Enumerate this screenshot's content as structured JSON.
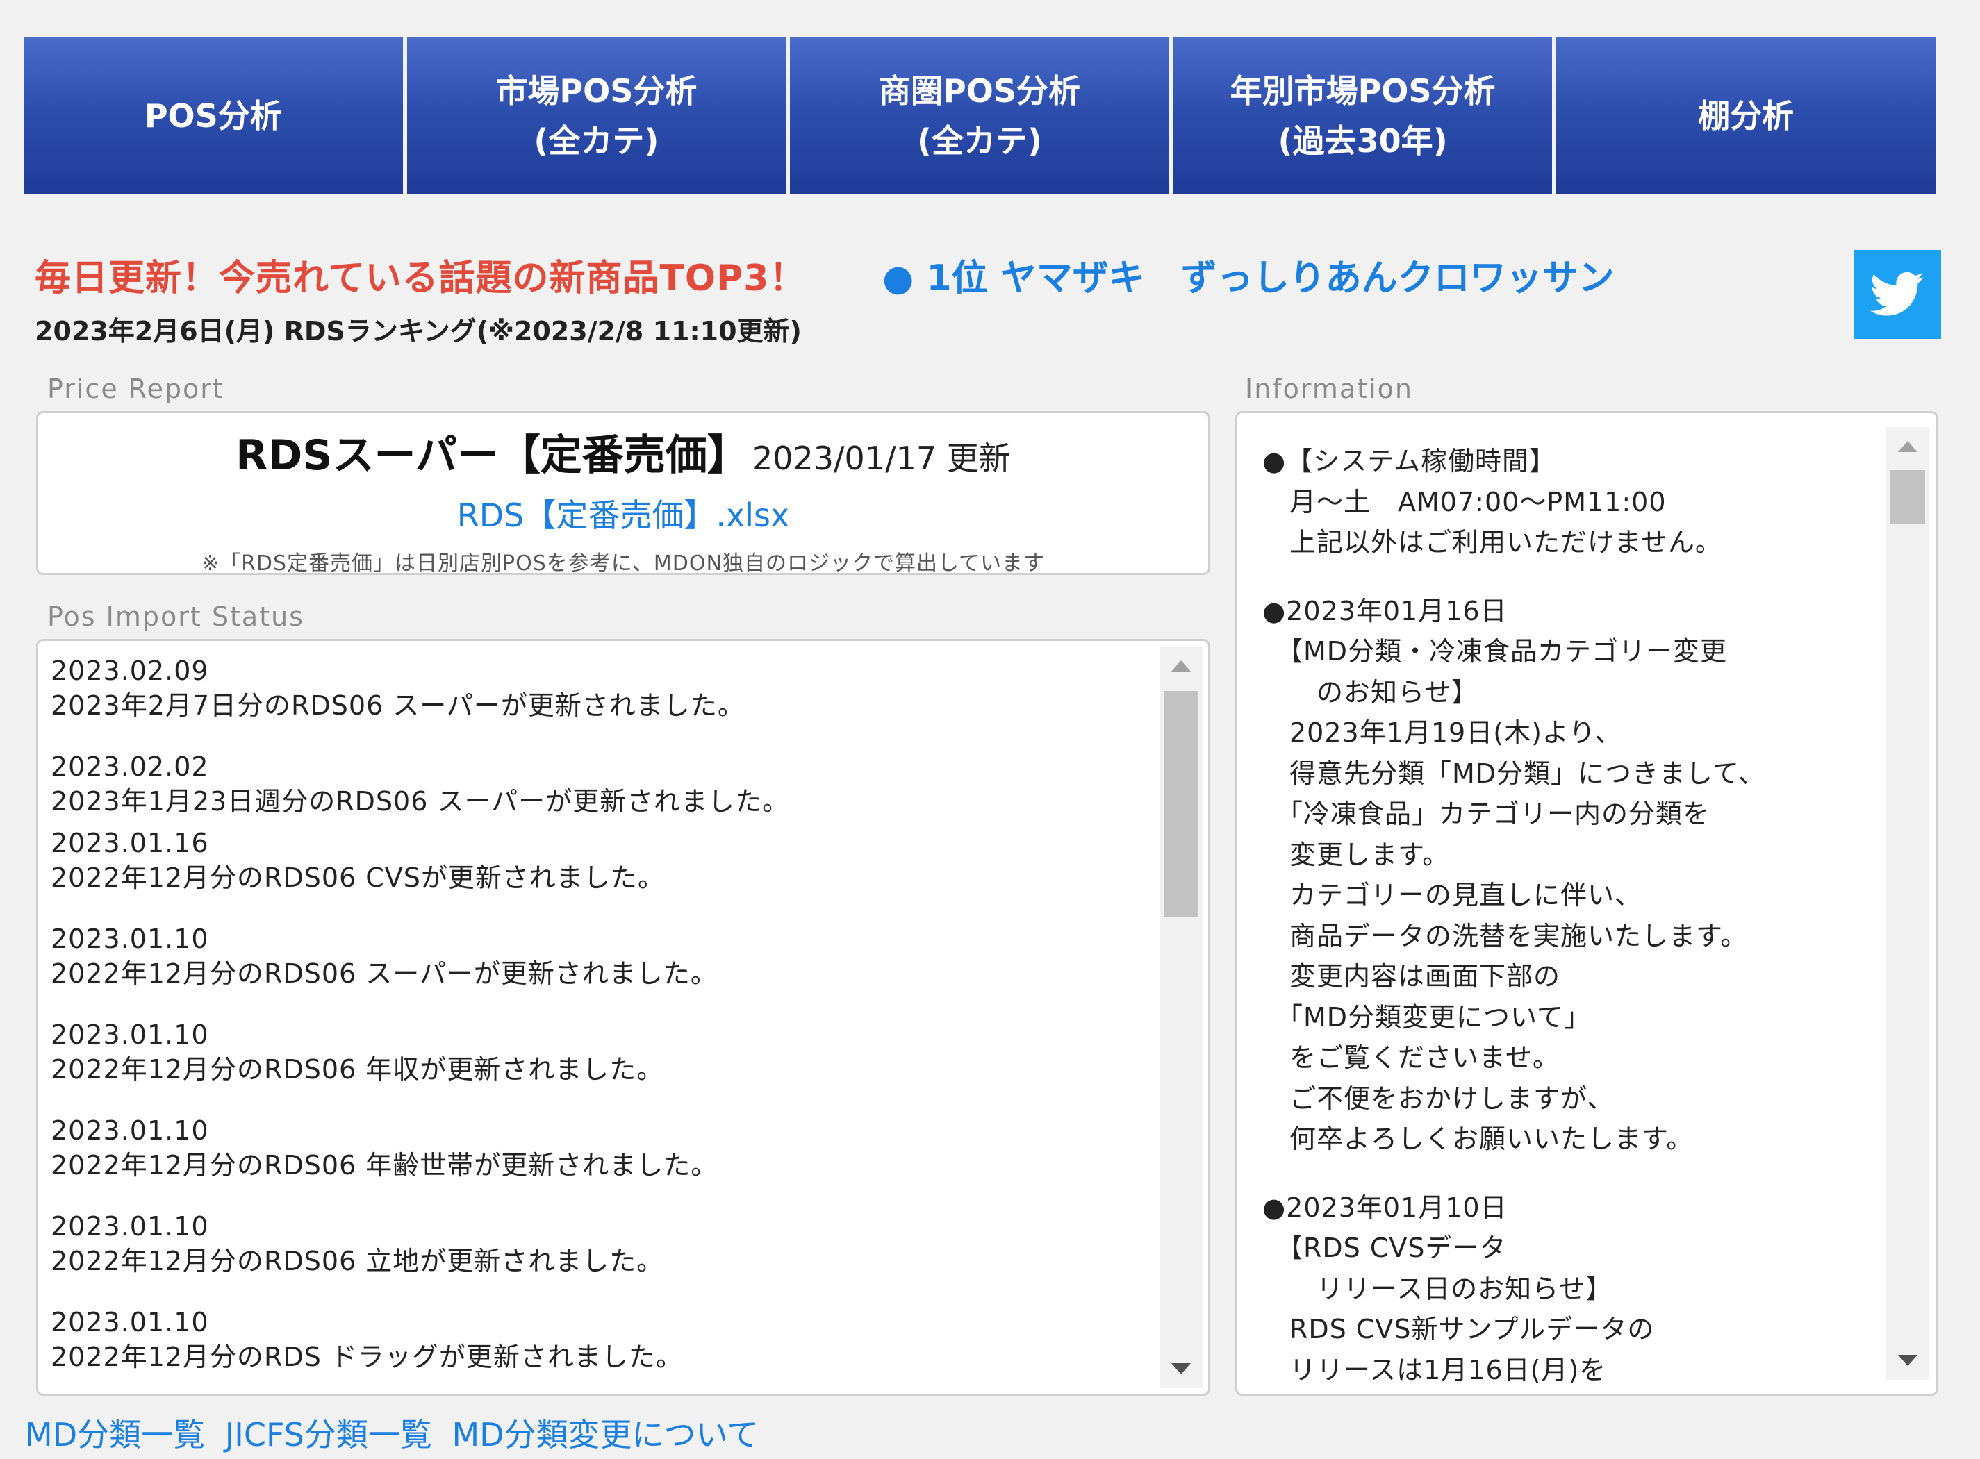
{
  "nav": [
    {
      "line1": "POS分析",
      "line2": ""
    },
    {
      "line1": "市場POS分析",
      "line2": "(全カテ)"
    },
    {
      "line1": "商圏POS分析",
      "line2": "(全カテ)"
    },
    {
      "line1": "年別市場POS分析",
      "line2": "(過去30年)"
    },
    {
      "line1": "棚分析",
      "line2": ""
    }
  ],
  "headline": {
    "text": "毎日更新！今売れている話題の新商品TOP3！",
    "top_item": "● 1位 ヤマザキ　ずっしりあんクロワッサン",
    "subtitle": "2023年2月6日(月) RDSランキング(※2023/2/8 11:10更新)",
    "twitter_icon": "twitter-bird-icon"
  },
  "price_report": {
    "label": "Price Report",
    "title": "RDSスーパー【定番売価】",
    "date": "2023/01/17 更新",
    "link": "RDS【定番売価】.xlsx",
    "note": "※「RDS定番売価」は日別店別POSを参考に、MDON独自のロジックで算出しています"
  },
  "pos_import": {
    "label": "Pos Import Status",
    "entries": [
      {
        "date": "2023.02.09",
        "text": "2023年2月7日分のRDS06 スーパーが更新されました。"
      },
      {
        "date": "2023.02.02",
        "text": "2023年1月23日週分のRDS06 スーパーが更新されました。"
      },
      {
        "date": "2023.01.16",
        "text": "2022年12月分のRDS06 CVSが更新されました。"
      },
      {
        "date": "2023.01.10",
        "text": "2022年12月分のRDS06 スーパーが更新されました。"
      },
      {
        "date": "2023.01.10",
        "text": "2022年12月分のRDS06 年収が更新されました。"
      },
      {
        "date": "2023.01.10",
        "text": "2022年12月分のRDS06 年齢世帯が更新されました。"
      },
      {
        "date": "2023.01.10",
        "text": "2022年12月分のRDS06 立地が更新されました。"
      },
      {
        "date": "2023.01.10",
        "text": "2022年12月分のRDS ドラッグが更新されました。"
      }
    ]
  },
  "information": {
    "label": "Information",
    "lines": [
      "●【システム稼働時間】",
      "　月～土　AM07:00～PM11:00",
      "　上記以外はご利用いただけません。",
      "",
      "●2023年01月16日",
      "　【MD分類・冷凍食品カテゴリー変更",
      "　　のお知らせ】",
      "　2023年1月19日(木)より、",
      "　得意先分類「MD分類」につきまして、",
      "　「冷凍食品」カテゴリー内の分類を",
      "　変更します。",
      "　カテゴリーの見直しに伴い、",
      "　商品データの洗替を実施いたします。",
      "　変更内容は画面下部の",
      "　「MD分類変更について」",
      "　をご覧くださいませ。",
      "　ご不便をおかけしますが、",
      "　何卒よろしくお願いいたします。",
      "",
      "●2023年01月10日",
      "　【RDS CVSデータ",
      "　　リリース日のお知らせ】",
      "　RDS CVS新サンプルデータの",
      "　リリースは1月16日(月)を"
    ]
  },
  "footer_links": [
    "MD分類一覧",
    "JICFS分類一覧",
    "MD分類変更について"
  ],
  "colors": {
    "nav_bg": "#2e4fae",
    "headline_red": "#e24b3b",
    "link_blue": "#1a7fe0",
    "twitter_blue": "#1da1f2"
  }
}
